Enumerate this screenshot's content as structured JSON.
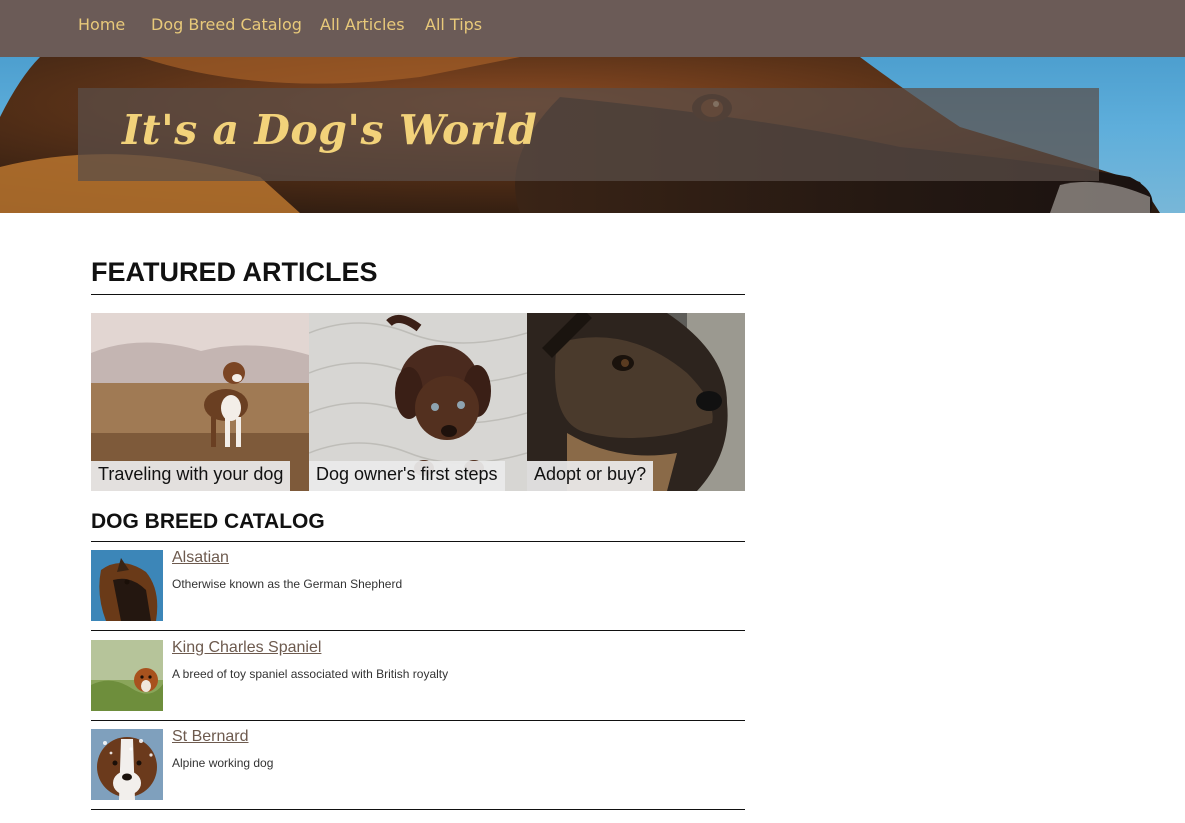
{
  "nav": {
    "home": "Home",
    "catalog": "Dog Breed Catalog",
    "articles": "All Articles",
    "tips": "All Tips"
  },
  "hero": {
    "title": "It's a Dog's World"
  },
  "featured": {
    "heading": "FEATURED ARTICLES",
    "articles": [
      {
        "label": "Traveling with your dog"
      },
      {
        "label": "Dog owner's first steps"
      },
      {
        "label": "Adopt or buy?"
      }
    ]
  },
  "catalog": {
    "heading": "DOG BREED CATALOG",
    "breeds": [
      {
        "name": "Alsatian",
        "description": "Otherwise known as the German Shepherd"
      },
      {
        "name": "King Charles Spaniel",
        "description": "A breed of toy spaniel associated with British royalty"
      },
      {
        "name": "St Bernard",
        "description": "Alpine working dog"
      }
    ]
  },
  "colors": {
    "nav_bg": "#6b5b57",
    "nav_link": "#e8c97a",
    "title_accent": "#f2d27a",
    "breed_link": "#6d5a4e"
  }
}
